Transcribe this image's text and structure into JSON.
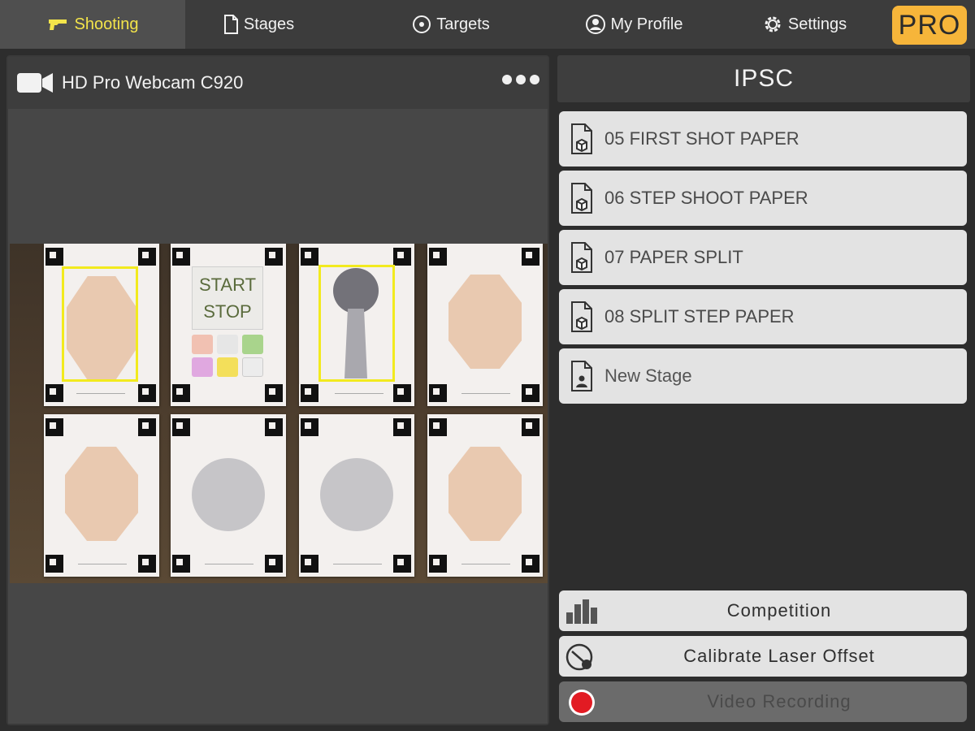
{
  "nav": {
    "tabs": [
      {
        "label": "Shooting",
        "icon": "pistol-icon",
        "active": true
      },
      {
        "label": "Stages",
        "icon": "document-icon"
      },
      {
        "label": "Targets",
        "icon": "target-icon"
      },
      {
        "label": "My Profile",
        "icon": "user-icon"
      },
      {
        "label": "Settings",
        "icon": "gear-icon"
      }
    ],
    "pro_label": "PRO"
  },
  "camera": {
    "title": "HD Pro Webcam C920",
    "feed": {
      "start_label": "START",
      "stop_label": "STOP"
    }
  },
  "stages": {
    "header": "IPSC",
    "items": [
      {
        "label": "05 FIRST SHOT PAPER",
        "icon": "stage-file-icon"
      },
      {
        "label": "06 STEP SHOOT PAPER",
        "icon": "stage-file-icon"
      },
      {
        "label": "07 PAPER SPLIT",
        "icon": "stage-file-icon"
      },
      {
        "label": "08 SPLIT STEP PAPER",
        "icon": "stage-file-icon"
      },
      {
        "label": "New Stage",
        "icon": "new-stage-icon"
      }
    ]
  },
  "actions": {
    "competition": "Competition",
    "calibrate": "Calibrate Laser Offset",
    "video": "Video Recording"
  },
  "colors": {
    "accent_active_tab": "#f3e44a",
    "pro_badge": "#f6b53a",
    "selection_box": "#f2ea1e",
    "record": "#e21b23"
  }
}
